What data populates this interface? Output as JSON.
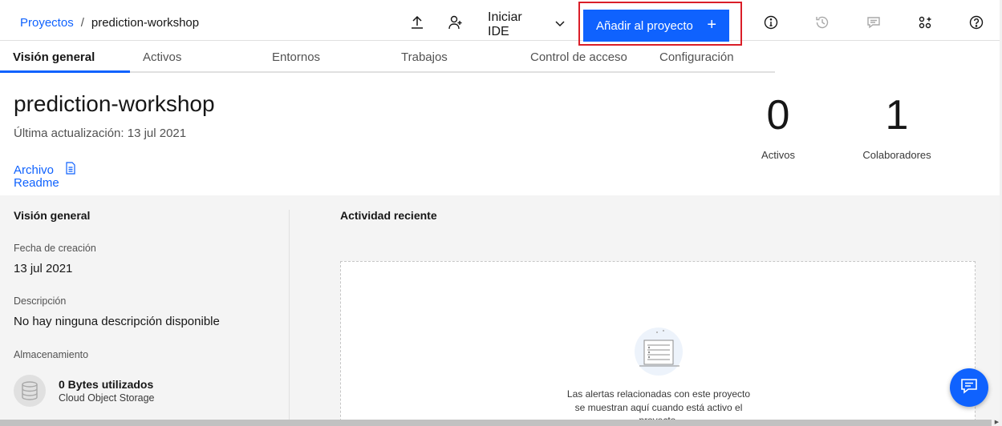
{
  "breadcrumb": {
    "parent": "Proyectos",
    "separator": "/",
    "current": "prediction-workshop"
  },
  "header": {
    "ide_label": "Iniciar IDE",
    "add_label": "Añadir al proyecto",
    "add_plus": "+"
  },
  "tabs": [
    {
      "label": "Visión general",
      "active": true
    },
    {
      "label": "Activos"
    },
    {
      "label": "Entornos"
    },
    {
      "label": "Trabajos"
    },
    {
      "label": "Control de acceso"
    },
    {
      "label": "Configuración"
    }
  ],
  "project": {
    "title": "prediction-workshop",
    "updated": "Última actualización: 13 jul 2021",
    "file_link": "Archivo",
    "readme_link": "Readme"
  },
  "stats": [
    {
      "value": "0",
      "label": "Activos"
    },
    {
      "value": "1",
      "label": "Colaboradores"
    }
  ],
  "overview": {
    "title": "Visión general",
    "created_label": "Fecha de creación",
    "created_value": "13 jul 2021",
    "description_label": "Descripción",
    "description_value": "No hay ninguna descripción disponible",
    "storage_label": "Almacenamiento",
    "storage_used": "0 Bytes utilizados",
    "storage_type": "Cloud Object Storage"
  },
  "activity": {
    "title": "Actividad reciente",
    "empty_line1": "Las alertas relacionadas con este proyecto",
    "empty_line2": "se muestran aquí cuando está activo el",
    "empty_line3": "proyecto."
  },
  "colors": {
    "primary": "#0f62fe",
    "highlight": "#da1e28",
    "background": "#f4f4f4"
  },
  "icons": [
    "upload-icon",
    "add-user-icon",
    "chevron-down-icon",
    "info-icon",
    "history-icon",
    "comment-icon",
    "apps-icon",
    "help-icon",
    "document-icon",
    "database-icon",
    "chat-icon"
  ]
}
